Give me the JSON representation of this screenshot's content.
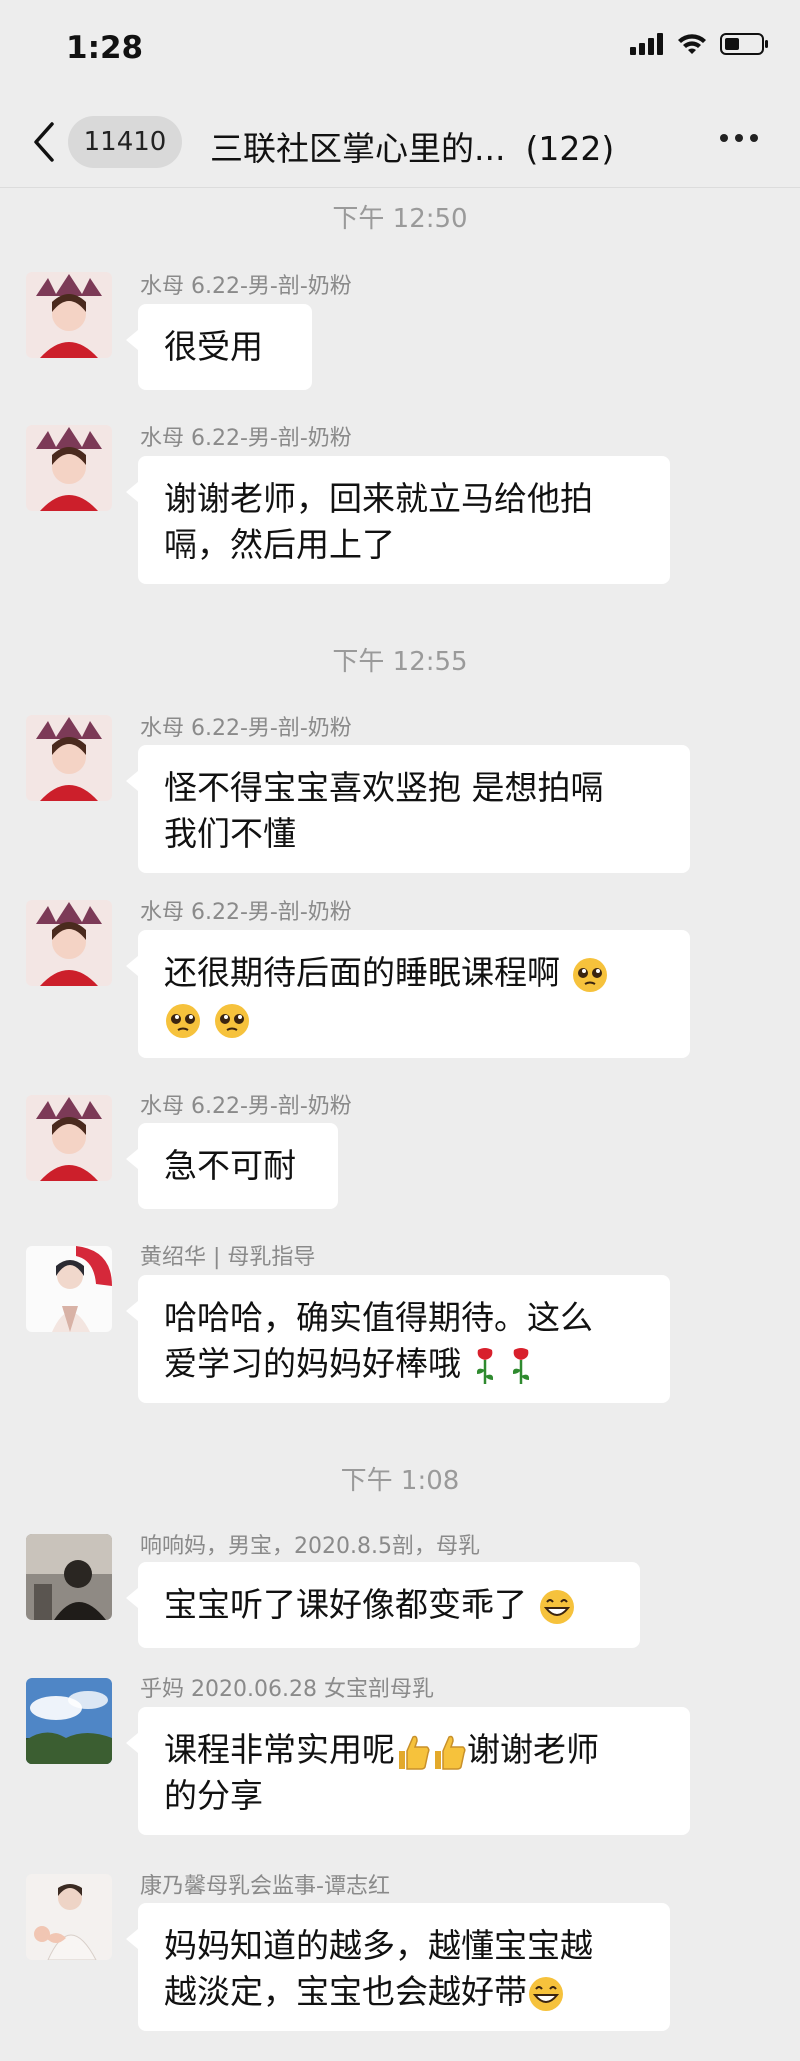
{
  "status_bar": {
    "time": "1:28"
  },
  "header": {
    "unread_count": "11410",
    "title": "三联社区掌心里的...",
    "member_count": "(122)"
  },
  "messages": [
    {
      "type": "time",
      "text": "下午 12:50"
    },
    {
      "type": "msg",
      "sender": "水母 6.22-男-剖-奶粉",
      "text": "很受用"
    },
    {
      "type": "msg",
      "sender": "水母 6.22-男-剖-奶粉",
      "line1": "谢谢老师，回来就立马给他拍",
      "line2": "嗝，然后用上了"
    },
    {
      "type": "time",
      "text": "下午 12:55"
    },
    {
      "type": "msg",
      "sender": "水母 6.22-男-剖-奶粉",
      "line1": "怪不得宝宝喜欢竖抱 是想拍嗝",
      "line2": "我们不懂"
    },
    {
      "type": "msg",
      "sender": "水母 6.22-男-剖-奶粉",
      "line1": "还很期待后面的睡眠课程啊"
    },
    {
      "type": "msg",
      "sender": "水母 6.22-男-剖-奶粉",
      "text": "急不可耐"
    },
    {
      "type": "msg",
      "sender": "黄绍华 | 母乳指导",
      "line1": "哈哈哈，确实值得期待。这么",
      "line2": "爱学习的妈妈好棒哦"
    },
    {
      "type": "time",
      "text": "下午 1:08"
    },
    {
      "type": "msg",
      "sender": "响响妈，男宝，2020.8.5剖，母乳",
      "text": "宝宝听了课好像都变乖了"
    },
    {
      "type": "msg",
      "sender": "乎妈 2020.06.28 女宝剖母乳",
      "line1": "课程非常实用呢",
      "line1b": "谢谢老师",
      "line2": "的分享"
    },
    {
      "type": "msg",
      "sender": "康乃馨母乳会监事-谭志红",
      "line1": "妈妈知道的越多，越懂宝宝越",
      "line2": "越淡定，宝宝也会越好带"
    }
  ],
  "icons": {
    "status": [
      "signal-icon",
      "wifi-icon",
      "battery-icon"
    ],
    "emojis": [
      "pleading-face-emoji",
      "rose-emoji",
      "grinning-face-emoji",
      "thumbs-up-emoji"
    ]
  }
}
